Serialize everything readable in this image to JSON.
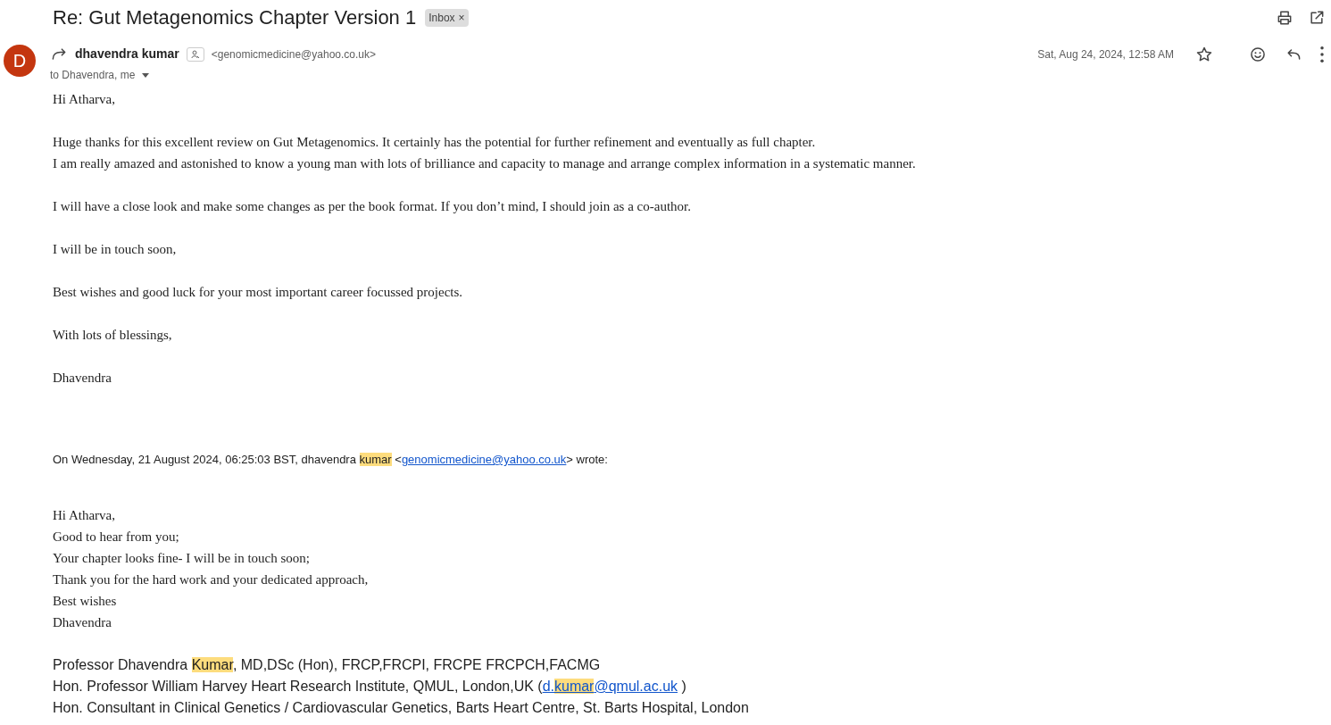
{
  "subject": "Re: Gut Metagenomics Chapter Version 1",
  "label": {
    "text": "Inbox",
    "remove": "×"
  },
  "sender": {
    "initial": "D",
    "name": "dhavendra kumar",
    "email": "<genomicmedicine@yahoo.co.uk>",
    "recipients": "to Dhavendra, me",
    "date": "Sat, Aug 24, 2024, 12:58 AM",
    "starred": false
  },
  "body": [
    [
      "Hi Atharva,"
    ],
    [
      "Huge thanks for this excellent review on Gut Metagenomics. It certainly has the potential for further refinement and eventually as full chapter.",
      "I am really amazed and astonished to know a young man with lots of brilliance and capacity to manage and arrange complex information in a systematic manner."
    ],
    [
      "I will have a close look and make some changes as per the book format. If you don’t mind, I should join as a co-author."
    ],
    [
      "I will be in touch soon,"
    ],
    [
      "Best wishes and good luck for your most important career focussed projects."
    ],
    [
      "With lots of blessings,"
    ],
    [
      "Dhavendra"
    ]
  ],
  "quote_header": [
    {
      "text": "On Wednesday, 21 August 2024, 06:25:03 BST, dhavendra ",
      "highlight": false,
      "link": false
    },
    {
      "text": "kumar",
      "highlight": true,
      "link": false
    },
    {
      "text": " <",
      "highlight": false,
      "link": false
    },
    {
      "text": "genomicmedicine@yahoo.co.uk",
      "highlight": false,
      "link": true
    },
    {
      "text": "> wrote:",
      "highlight": false,
      "link": false
    }
  ],
  "quoted_lines": [
    "Hi Atharva,",
    "Good to hear from you;",
    "Your chapter looks fine- I will be in touch soon;",
    "Thank you for the hard work and your dedicated approach,",
    "Best wishes",
    "Dhavendra"
  ],
  "signature": [
    [
      {
        "text": "Professor Dhavendra ",
        "highlight": false,
        "link": false
      },
      {
        "text": "Kumar",
        "highlight": true,
        "link": false
      },
      {
        "text": ", MD,DSc (Hon), FRCP,FRCPI, FRCPE FRCPCH,FACMG",
        "highlight": false,
        "link": false
      }
    ],
    [
      {
        "text": "Hon. Professor William Harvey Heart Research Institute, QMUL, London,UK (",
        "highlight": false,
        "link": false
      },
      {
        "text": "d.",
        "highlight": false,
        "link": true
      },
      {
        "text": "kumar",
        "highlight": true,
        "link": true
      },
      {
        "text": "@qmul.ac.uk",
        "highlight": false,
        "link": true
      },
      {
        "text": " )",
        "highlight": false,
        "link": false
      }
    ],
    [
      {
        "text": "Hon. Consultant in Clinical Genetics / Cardiovascular Genetics, Barts Heart Centre, St. Barts Hospital, London",
        "highlight": false,
        "link": false
      }
    ]
  ]
}
